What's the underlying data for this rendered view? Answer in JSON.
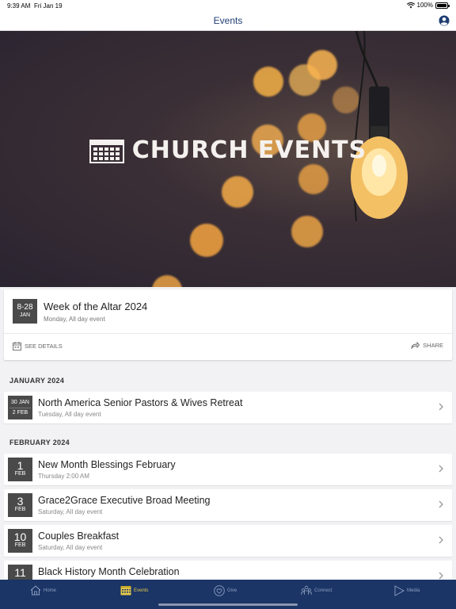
{
  "status": {
    "time": "9:39 AM",
    "date": "Fri Jan 19",
    "battery": "100%"
  },
  "nav": {
    "title": "Events"
  },
  "hero": {
    "title": "CHURCH EVENTS"
  },
  "featured": {
    "date_top": "8-28",
    "date_bottom": "JAN",
    "title": "Week of the Altar 2024",
    "subtitle": "Monday, All day event",
    "see_details": "SEE DETAILS",
    "share": "SHARE"
  },
  "sections": [
    {
      "header": "JANUARY 2024",
      "events": [
        {
          "date_start": "30 JAN",
          "date_end": "2 FEB",
          "title": "North America Senior Pastors & Wives Retreat",
          "subtitle": "Tuesday, All day event"
        }
      ]
    },
    {
      "header": "FEBRUARY 2024",
      "events": [
        {
          "day": "1",
          "month": "FEB",
          "title": "New Month Blessings February",
          "subtitle": "Thursday 2:00 AM"
        },
        {
          "day": "3",
          "month": "FEB",
          "title": "Grace2Grace Executive Broad Meeting",
          "subtitle": "Saturday, All day event"
        },
        {
          "day": "10",
          "month": "FEB",
          "title": "Couples Breakfast",
          "subtitle": "Saturday, All day event"
        },
        {
          "day": "11",
          "month": "",
          "title": "Black History Month Celebration",
          "subtitle": ""
        }
      ]
    }
  ],
  "tabs": [
    {
      "label": "Home",
      "icon": "home-icon"
    },
    {
      "label": "Events",
      "icon": "calendar-icon",
      "active": true
    },
    {
      "label": "Give",
      "icon": "heart-icon"
    },
    {
      "label": "Connect",
      "icon": "people-icon"
    },
    {
      "label": "Media",
      "icon": "play-icon"
    }
  ],
  "colors": {
    "tab_bar": "#1a3566",
    "accent": "#e6c84a",
    "nav_title": "#1f3d73",
    "date_box": "#4a4a4a"
  }
}
